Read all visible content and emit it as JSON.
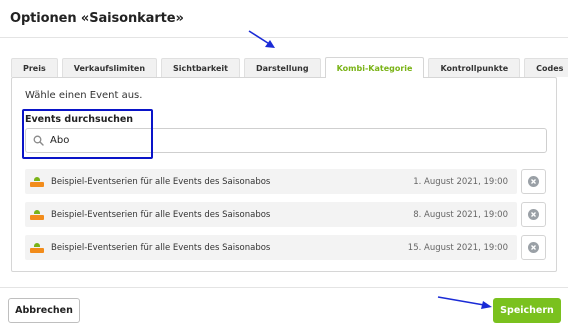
{
  "dialog": {
    "title": "Optionen «Saisonkarte»"
  },
  "tabs": [
    {
      "label": "Preis",
      "active": false
    },
    {
      "label": "Verkaufslimiten",
      "active": false
    },
    {
      "label": "Sichtbarkeit",
      "active": false
    },
    {
      "label": "Darstellung",
      "active": false
    },
    {
      "label": "Kombi-Kategorie",
      "active": true
    },
    {
      "label": "Kontrollpunkte",
      "active": false
    },
    {
      "label": "Codes",
      "active": false
    }
  ],
  "panel": {
    "hint": "Wähle einen Event aus.",
    "search": {
      "label": "Events durchsuchen",
      "value": "Abo",
      "placeholder": ""
    },
    "events": [
      {
        "name": "Beispiel-Eventserien für alle Events des Saisonabos",
        "date": "1. August 2021, 19:00",
        "icon": "event-logo-icon"
      },
      {
        "name": "Beispiel-Eventserien für alle Events des Saisonabos",
        "date": "8. August 2021, 19:00",
        "icon": "event-logo-icon"
      },
      {
        "name": "Beispiel-Eventserien für alle Events des Saisonabos",
        "date": "15. August 2021, 19:00",
        "icon": "event-logo-icon"
      }
    ]
  },
  "footer": {
    "cancel_label": "Abbrechen",
    "save_label": "Speichern"
  },
  "colors": {
    "accent": "#7ac11e",
    "active_tab_text": "#7ab317",
    "highlight": "#0a14c8",
    "annotation_arrow": "#1a2bd6"
  }
}
